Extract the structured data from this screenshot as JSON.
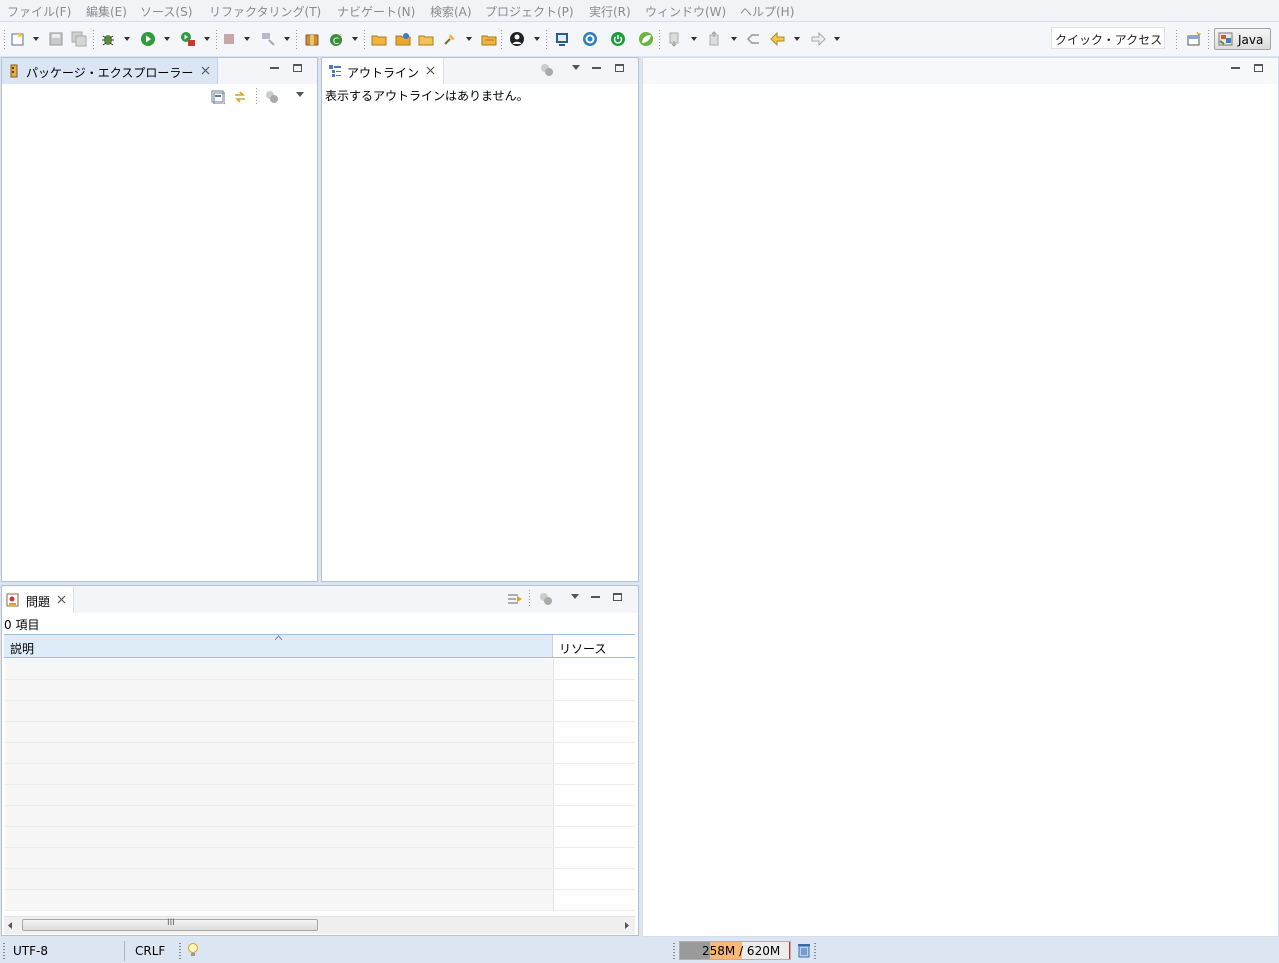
{
  "menu": {
    "items": [
      "ファイル(F)",
      "編集(E)",
      "ソース(S)",
      "リファクタリング(T)",
      "ナビゲート(N)",
      "検索(A)",
      "プロジェクト(P)",
      "実行(R)",
      "ウィンドウ(W)",
      "ヘルプ(H)"
    ]
  },
  "toolbar": {
    "quick_access": "クイック・アクセス",
    "perspective": "Java"
  },
  "package_explorer": {
    "title": "パッケージ・エクスプローラー"
  },
  "outline": {
    "title": "アウトライン",
    "message": "表示するアウトラインはありません。"
  },
  "problems": {
    "title": "問題",
    "count": "0 項目",
    "columns": [
      "説明",
      "リソース"
    ]
  },
  "status": {
    "encoding": "UTF-8",
    "line_delimiter": "CRLF",
    "heap": "258M / 620M",
    "heap_used_fraction": 0.416
  },
  "colors": {
    "active_tab": "#dae6f4",
    "selection_header": "#ddecf8",
    "heap_fill": "#f9b877"
  }
}
